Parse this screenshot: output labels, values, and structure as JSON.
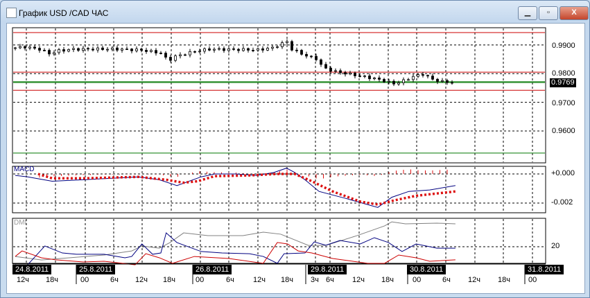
{
  "window": {
    "title": "График USD /CAD  ЧАС",
    "minimize": "▁",
    "maximize": "▫",
    "close": "X"
  },
  "price_panel": {
    "axis_labels": [
      "0.9900",
      "0.9800",
      "0.9700",
      "0.9600"
    ],
    "axis_values": [
      0.99,
      0.98,
      0.97,
      0.96
    ],
    "current_price": "0.9769",
    "current_value": 0.9769,
    "range": [
      0.9489,
      0.996
    ],
    "red_levels": [
      0.9943,
      0.9805,
      0.9742
    ],
    "green_levels": [
      0.9772,
      0.9523
    ],
    "close_keypoints": [
      [
        0,
        0.989
      ],
      [
        2,
        0.9893
      ],
      [
        5,
        0.9885
      ],
      [
        7,
        0.987
      ],
      [
        9,
        0.988
      ],
      [
        12,
        0.9885
      ],
      [
        20,
        0.9886
      ],
      [
        26,
        0.9882
      ],
      [
        30,
        0.9872
      ],
      [
        31.5,
        0.9845
      ],
      [
        33,
        0.986
      ],
      [
        37,
        0.9878
      ],
      [
        40,
        0.9885
      ],
      [
        50,
        0.9883
      ],
      [
        53,
        0.989
      ],
      [
        55,
        0.9905
      ],
      [
        56,
        0.9912
      ],
      [
        57,
        0.9885
      ],
      [
        60,
        0.9862
      ],
      [
        62,
        0.9852
      ],
      [
        63.5,
        0.982
      ],
      [
        66,
        0.9807
      ],
      [
        70,
        0.9795
      ],
      [
        74,
        0.9783
      ],
      [
        76,
        0.9775
      ],
      [
        78,
        0.9765
      ],
      [
        80,
        0.9775
      ],
      [
        82,
        0.979
      ],
      [
        84,
        0.9798
      ],
      [
        86,
        0.978
      ],
      [
        88,
        0.9772
      ],
      [
        90,
        0.977
      ]
    ]
  },
  "macd_panel": {
    "label": "MACD",
    "axis_labels": [
      "+0.000",
      "-0.002"
    ],
    "unit": "0.0001",
    "main": [
      [
        0,
        -1
      ],
      [
        2.6,
        -2
      ],
      [
        7.6,
        -5
      ],
      [
        14,
        -4
      ],
      [
        25.4,
        -2
      ],
      [
        29.7,
        -4
      ],
      [
        33.3,
        -8
      ],
      [
        38.3,
        -2
      ],
      [
        41.1,
        0
      ],
      [
        45.4,
        0
      ],
      [
        49.7,
        -1
      ],
      [
        53.3,
        1
      ],
      [
        55.9,
        4
      ],
      [
        57.6,
        1
      ],
      [
        59.7,
        -4
      ],
      [
        62.6,
        -12
      ],
      [
        68.3,
        -17
      ],
      [
        74.7,
        -23
      ],
      [
        77.6,
        -16
      ],
      [
        81.1,
        -12
      ],
      [
        85.4,
        -11
      ],
      [
        90.7,
        -8
      ]
    ],
    "signal": [
      [
        4.7,
        0
      ],
      [
        7.6,
        -3
      ],
      [
        14,
        -3
      ],
      [
        25.4,
        -2
      ],
      [
        31.1,
        -4
      ],
      [
        34.7,
        -6
      ],
      [
        37.6,
        -5
      ],
      [
        41.1,
        -1.5
      ],
      [
        48.3,
        -1
      ],
      [
        54,
        0
      ],
      [
        57.6,
        0
      ],
      [
        61.1,
        -5
      ],
      [
        65.4,
        -12
      ],
      [
        71.1,
        -19
      ],
      [
        74.7,
        -21
      ],
      [
        78.3,
        -18
      ],
      [
        82.6,
        -15
      ],
      [
        90.7,
        -12
      ]
    ]
  },
  "dmi_panel": {
    "label": "DMI",
    "axis_labels": [
      "20"
    ],
    "adx": [
      [
        0,
        13.3
      ],
      [
        5.4,
        10.9
      ],
      [
        11.1,
        12.4
      ],
      [
        18.3,
        14.3
      ],
      [
        24,
        17.1
      ],
      [
        26.1,
        20.5
      ],
      [
        29.7,
        19
      ],
      [
        31.9,
        22.9
      ],
      [
        34.7,
        29.5
      ],
      [
        39.7,
        27.6
      ],
      [
        46.9,
        27.6
      ],
      [
        51.1,
        30
      ],
      [
        54.7,
        28.6
      ],
      [
        60.4,
        20.9
      ],
      [
        64,
        20.9
      ],
      [
        70.4,
        27.6
      ],
      [
        76.1,
        34.3
      ],
      [
        77.6,
        37.1
      ],
      [
        80.4,
        35.7
      ],
      [
        86.9,
        36.2
      ],
      [
        90.7,
        35.7
      ]
    ],
    "plus_di": [
      [
        0,
        7.6
      ],
      [
        1.9,
        5.2
      ],
      [
        6.1,
        20.5
      ],
      [
        9.7,
        15.7
      ],
      [
        12.6,
        14.8
      ],
      [
        18.3,
        14.8
      ],
      [
        22.6,
        12.4
      ],
      [
        24,
        13.3
      ],
      [
        26.1,
        21.9
      ],
      [
        28.3,
        14.8
      ],
      [
        30,
        15.7
      ],
      [
        31.1,
        29.5
      ],
      [
        33.3,
        22.9
      ],
      [
        38.3,
        16.7
      ],
      [
        42.6,
        15.7
      ],
      [
        48.3,
        15.2
      ],
      [
        51.1,
        13.3
      ],
      [
        54,
        8.6
      ],
      [
        55.4,
        15.2
      ],
      [
        59.7,
        15.7
      ],
      [
        61.6,
        23.3
      ],
      [
        64,
        21
      ],
      [
        66.9,
        24.3
      ],
      [
        71.1,
        21.9
      ],
      [
        74,
        26.2
      ],
      [
        76.9,
        22.9
      ],
      [
        79.7,
        16.7
      ],
      [
        82.6,
        21.9
      ],
      [
        86.9,
        19
      ],
      [
        90.7,
        19
      ]
    ],
    "minus_di": [
      [
        0,
        13.3
      ],
      [
        1.4,
        17.1
      ],
      [
        5.4,
        12.4
      ],
      [
        8.3,
        11
      ],
      [
        14,
        9.5
      ],
      [
        18.3,
        10
      ],
      [
        24.7,
        7.6
      ],
      [
        26.9,
        15.2
      ],
      [
        29.7,
        12.4
      ],
      [
        32.4,
        8.6
      ],
      [
        36.9,
        13.3
      ],
      [
        44,
        11.9
      ],
      [
        51.1,
        8.6
      ],
      [
        54,
        22.9
      ],
      [
        56.1,
        21.9
      ],
      [
        58.3,
        17.1
      ],
      [
        61.1,
        15.7
      ],
      [
        65.4,
        11.9
      ],
      [
        72.6,
        8.6
      ],
      [
        76.1,
        8.6
      ],
      [
        79,
        14.3
      ],
      [
        82.6,
        12.4
      ],
      [
        85.4,
        10
      ],
      [
        90.7,
        11
      ]
    ]
  },
  "time_axis": {
    "dates": [
      "24.8.2011",
      "25.8.2011",
      "26.8.2011",
      "29.8.2011",
      "30.8.2011",
      "31.8.2011"
    ],
    "hours": [
      "12ч",
      "18ч",
      "00",
      "6ч",
      "12ч",
      "18ч",
      "00",
      "6ч",
      "12ч",
      "18ч",
      "3ч",
      "6ч",
      "12ч",
      "18ч",
      "00",
      "6ч",
      "12ч",
      "18ч",
      "00"
    ]
  },
  "colors": {
    "red": "#cc0000",
    "green": "#007700",
    "blue": "#000080",
    "gray": "#808080",
    "macd_signal": "#dd1111"
  }
}
